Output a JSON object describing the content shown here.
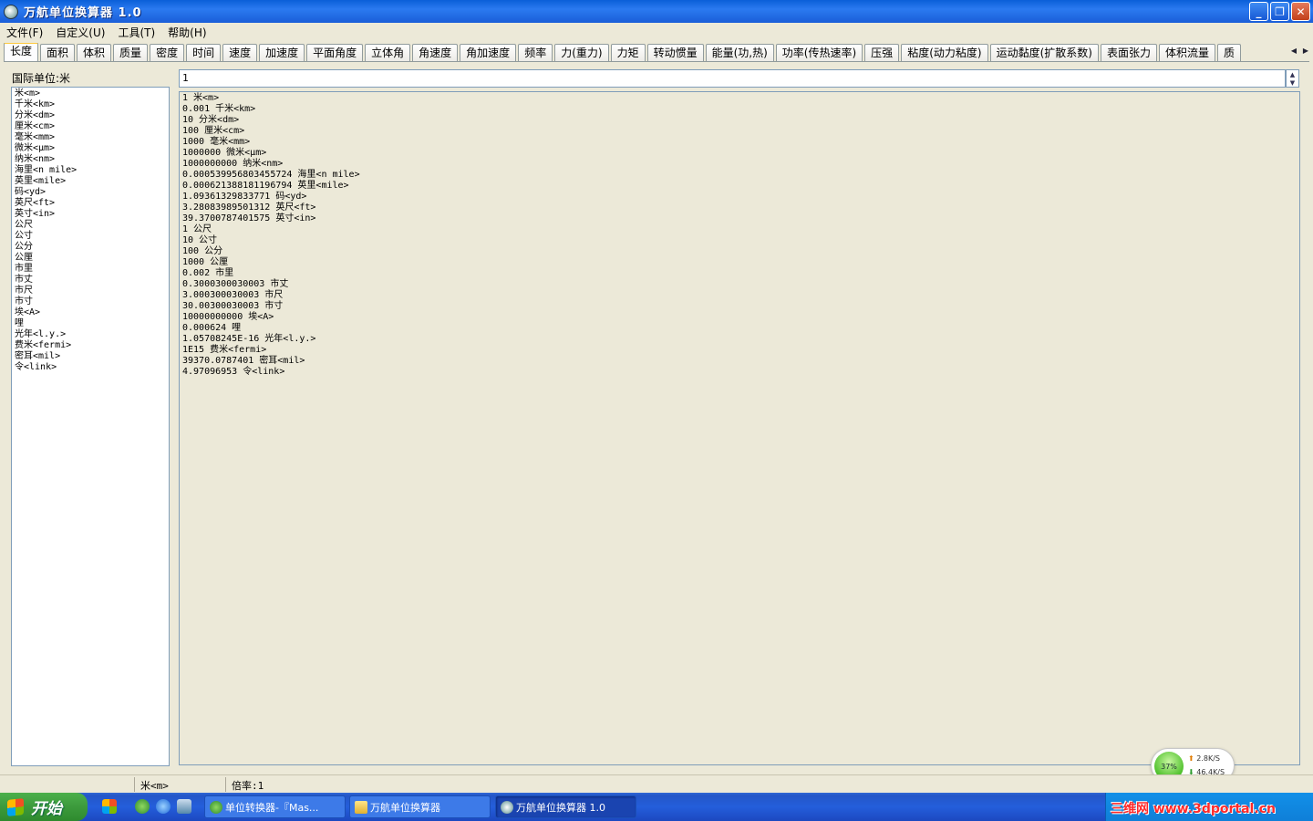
{
  "window": {
    "title": "万航单位换算器  1.0"
  },
  "menu": [
    "文件(F)",
    "自定义(U)",
    "工具(T)",
    "帮助(H)"
  ],
  "tabs": [
    "长度",
    "面积",
    "体积",
    "质量",
    "密度",
    "时间",
    "速度",
    "加速度",
    "平面角度",
    "立体角",
    "角速度",
    "角加速度",
    "频率",
    "力(重力)",
    "力矩",
    "转动惯量",
    "能量(功,热)",
    "功率(传热速率)",
    "压强",
    "粘度(动力粘度)",
    "运动黏度(扩散系数)",
    "表面张力",
    "体积流量",
    "质"
  ],
  "active_tab": "长度",
  "left_panel": {
    "caption": "国际单位:米",
    "units": [
      "米<m>",
      "千米<km>",
      "分米<dm>",
      "厘米<cm>",
      "毫米<mm>",
      "微米<μm>",
      "纳米<nm>",
      "海里<n mile>",
      "英里<mile>",
      "码<yd>",
      "英尺<ft>",
      "英寸<in>",
      "公尺",
      "公寸",
      "公分",
      "公厘",
      "市里",
      "市丈",
      "市尺",
      "市寸",
      "埃<A>",
      "哩",
      "光年<l.y.>",
      "费米<fermi>",
      "密耳<mil>",
      "令<link>"
    ]
  },
  "input": {
    "value": "1"
  },
  "results": [
    "1  米<m>",
    "0.001  千米<km>",
    "10  分米<dm>",
    "100  厘米<cm>",
    "1000  毫米<mm>",
    "1000000  微米<μm>",
    "1000000000  纳米<nm>",
    "0.000539956803455724  海里<n mile>",
    "0.000621388181196794  英里<mile>",
    "1.09361329833771  码<yd>",
    "3.28083989501312  英尺<ft>",
    "39.3700787401575  英寸<in>",
    "1  公尺",
    "10  公寸",
    "100  公分",
    "1000  公厘",
    "0.002  市里",
    "0.3000300030003  市丈",
    "3.000300030003  市尺",
    "30.00300030003  市寸",
    "10000000000  埃<A>",
    "0.000624  哩",
    "1.05708245E-16  光年<l.y.>",
    "1E15  费米<fermi>",
    "39370.0787401  密耳<mil>",
    "4.97096953  令<link>"
  ],
  "status": {
    "unit": "米<m>",
    "ratio": "倍率:1"
  },
  "network": {
    "percent": "37%",
    "up": "2.8K/S",
    "down": "46.4K/S"
  },
  "taskbar": {
    "start": "开始",
    "tasks": [
      "单位转换器-『Mas...",
      "万航单位换算器",
      "万航单位换算器  1.0"
    ]
  },
  "watermark": "三维网 www.3dportal.cn"
}
